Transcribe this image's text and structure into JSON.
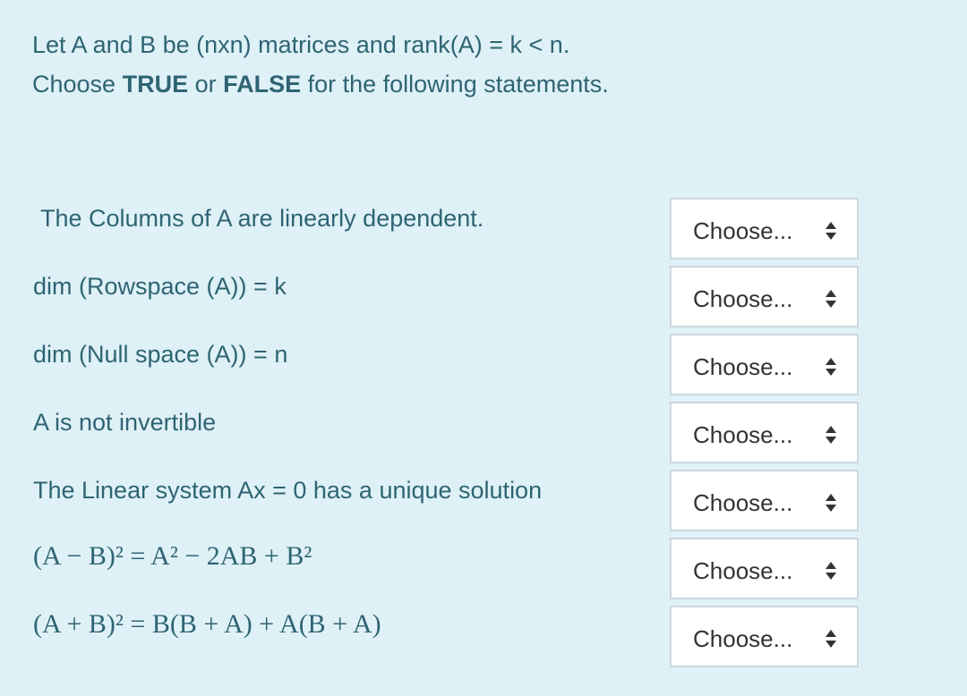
{
  "intro": {
    "line1": "Let A and B be (nxn) matrices and rank(A) = k < n.",
    "line2_prefix": "Choose ",
    "line2_true": "TRUE",
    "line2_mid": " or ",
    "line2_false": "FALSE",
    "line2_suffix": " for the following statements."
  },
  "statements": [
    {
      "text": "The Columns of A are linearly dependent.",
      "selected": "Choose..."
    },
    {
      "text": "dim (Rowspace (A)) = k",
      "selected": "Choose..."
    },
    {
      "text": "dim (Null space (A)) = n",
      "selected": "Choose..."
    },
    {
      "text": "A is not invertible",
      "selected": "Choose..."
    },
    {
      "text": "The Linear system Ax = 0 has a unique solution",
      "selected": "Choose..."
    },
    {
      "text": "(A − B)² = A² − 2AB + B²",
      "selected": "Choose..."
    },
    {
      "text": "(A + B)² = B(B + A) + A(B + A)",
      "selected": "Choose..."
    }
  ],
  "select_icon": "up-down-arrows-icon",
  "colors": {
    "background": "#def1f7",
    "text": "#2f6473",
    "select_border": "#cfd7dc"
  }
}
